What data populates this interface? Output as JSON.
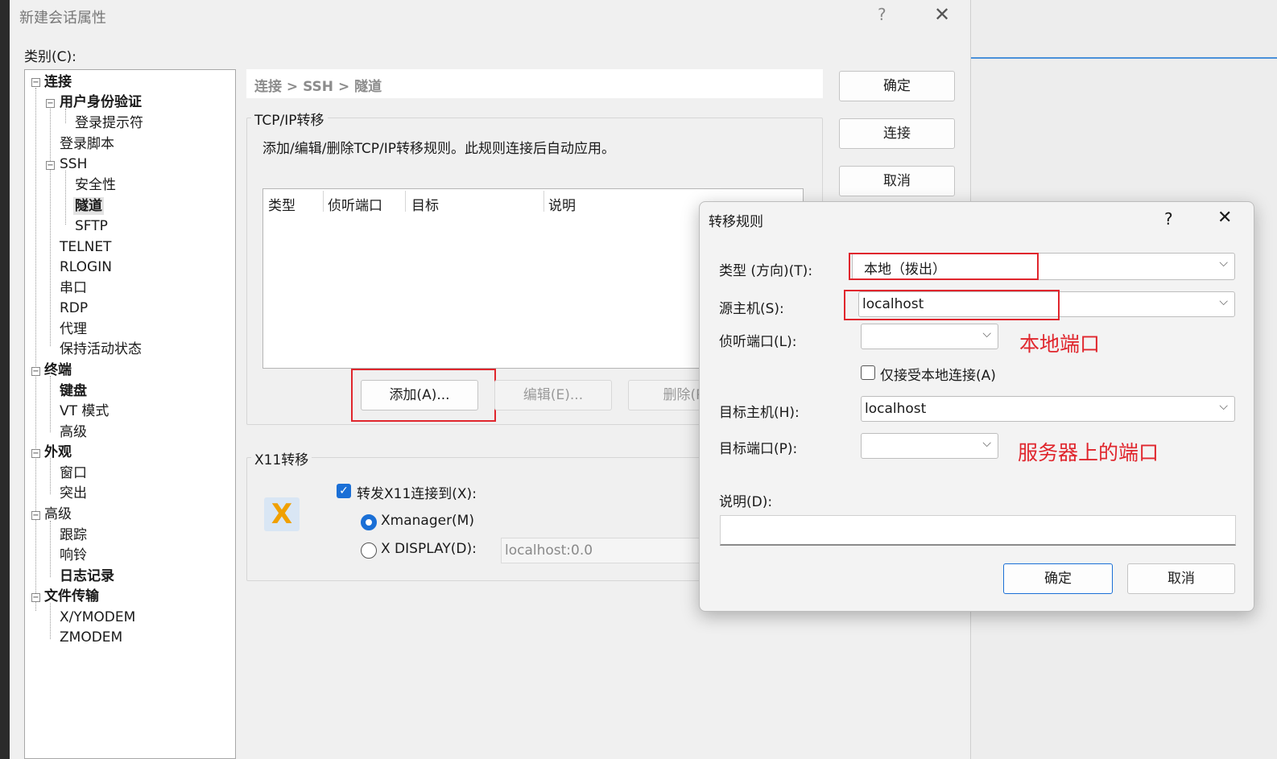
{
  "main_dialog": {
    "title": "新建会话属性",
    "help_glyph": "?",
    "close_glyph": "✕",
    "category_label": "类别(C):"
  },
  "tree": {
    "items": [
      {
        "label": "连接",
        "bold": true
      },
      {
        "label": "用户身份验证",
        "bold": true
      },
      {
        "label": "登录提示符"
      },
      {
        "label": "登录脚本"
      },
      {
        "label": "SSH"
      },
      {
        "label": "安全性"
      },
      {
        "label": "隧道",
        "bold": true,
        "selected": true
      },
      {
        "label": "SFTP"
      },
      {
        "label": "TELNET"
      },
      {
        "label": "RLOGIN"
      },
      {
        "label": "串口"
      },
      {
        "label": "RDP"
      },
      {
        "label": "代理"
      },
      {
        "label": "保持活动状态"
      },
      {
        "label": "终端",
        "bold": true
      },
      {
        "label": "键盘",
        "bold": true
      },
      {
        "label": "VT 模式"
      },
      {
        "label": "高级"
      },
      {
        "label": "外观",
        "bold": true
      },
      {
        "label": "窗口"
      },
      {
        "label": "突出"
      },
      {
        "label": "高级"
      },
      {
        "label": "跟踪"
      },
      {
        "label": "响铃"
      },
      {
        "label": "日志记录",
        "bold": true
      },
      {
        "label": "文件传输",
        "bold": true
      },
      {
        "label": "X/YMODEM"
      },
      {
        "label": "ZMODEM"
      }
    ]
  },
  "breadcrumb": "连接 > SSH > 隧道",
  "side_buttons": {
    "ok": "确定",
    "connect": "连接",
    "cancel": "取消"
  },
  "tcp_group": {
    "title": "TCP/IP转移",
    "description": "添加/编辑/删除TCP/IP转移规则。此规则连接后自动应用。",
    "columns": [
      "类型",
      "侦听端口",
      "目标",
      "说明"
    ],
    "add_button": "添加(A)...",
    "edit_button": "编辑(E)...",
    "delete_button": "删除(R)"
  },
  "x11_group": {
    "title": "X11转移",
    "forward_label": "转发X11连接到(X):",
    "forward_checked": true,
    "xmanager_label": "Xmanager(M)",
    "xdisplay_label": "X DISPLAY(D):",
    "selected_option": "Xmanager(M)",
    "xdisplay_value": "localhost:0.0",
    "icon_glyph": "X"
  },
  "rule_dialog": {
    "title": "转移规则",
    "help_glyph": "?",
    "close_glyph": "✕",
    "type_label": "类型 (方向)(T):",
    "type_value": "本地（拨出）",
    "source_host_label": "源主机(S):",
    "source_host_value": "localhost",
    "listen_port_label": "侦听端口(L):",
    "listen_port_value": "",
    "local_only_label": "仅接受本地连接(A)",
    "local_only_checked": false,
    "target_host_label": "目标主机(H):",
    "target_host_value": "localhost",
    "target_port_label": "目标端口(P):",
    "target_port_value": "",
    "desc_label": "说明(D):",
    "desc_value": "",
    "ok_button": "确定",
    "cancel_button": "取消",
    "dropdown_glyph": "⌵"
  },
  "annotations": {
    "local_port": "本地端口",
    "server_port": "服务器上的端口",
    "highlight_color": "#e0262d"
  },
  "colors": {
    "accent": "#1a6fd6",
    "annotation": "#e0262d"
  }
}
